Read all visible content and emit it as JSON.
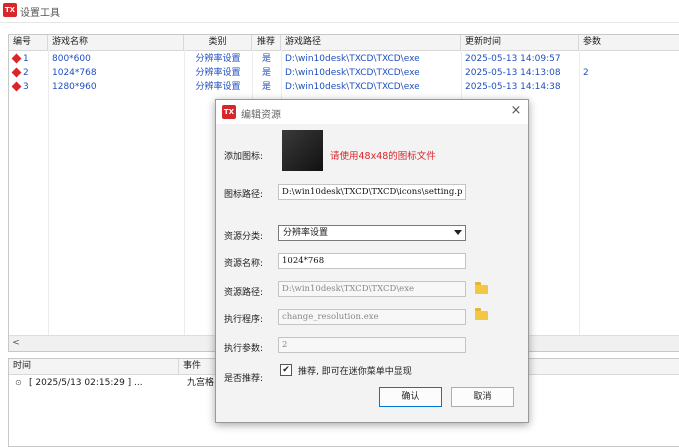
{
  "app": {
    "title": "设置工具",
    "logo_text": "TX"
  },
  "list": {
    "columns": [
      "编号",
      "游戏名称",
      "类别",
      "推荐",
      "游戏路径",
      "更新时间",
      "参数"
    ],
    "rows": [
      {
        "id": "1",
        "name": "800*600",
        "category": "分辨率设置",
        "recommend": "是",
        "path": "D:\\win10desk\\TXCD\\TXCD\\exe",
        "updated": "2025-05-13 14:09:57",
        "param": ""
      },
      {
        "id": "2",
        "name": "1024*768",
        "category": "分辨率设置",
        "recommend": "是",
        "path": "D:\\win10desk\\TXCD\\TXCD\\exe",
        "updated": "2025-05-13 14:13:08",
        "param": "2"
      },
      {
        "id": "3",
        "name": "1280*960",
        "category": "分辨率设置",
        "recommend": "是",
        "path": "D:\\win10desk\\TXCD\\TXCD\\exe",
        "updated": "2025-05-13 14:14:38",
        "param": ""
      }
    ],
    "scroll_left": "<"
  },
  "log": {
    "columns": [
      "时间",
      "事件"
    ],
    "rows": [
      {
        "time": "[ 2025/5/13 02:15:29 ] ...",
        "event": "九宫格"
      }
    ]
  },
  "dialog": {
    "title": "编辑资源",
    "close": "×",
    "labels": {
      "icon": "添加图标:",
      "icon_path": "图标路径:",
      "category": "资源分类:",
      "name": "资源名称:",
      "path": "资源路径:",
      "exe": "执行程序:",
      "params": "执行参数:",
      "recommend": "是否推荐:"
    },
    "icon_hint": "请使用48x48的图标文件",
    "icon_path_value": "D:\\win10desk\\TXCD\\TXCD\\icons\\setting.p",
    "category_value": "分辨率设置",
    "name_value": "1024*768",
    "path_value": "D:\\win10desk\\TXCD\\TXCD\\exe",
    "exe_value": "change_resolution.exe",
    "params_value": "2",
    "recommend_checked": "✔",
    "recommend_text": "推荐, 即可在迷你菜单中显现",
    "ok": "确认",
    "cancel": "取消"
  },
  "colors": {
    "accent_red": "#d8262b",
    "link_blue": "#1f4fbf"
  }
}
